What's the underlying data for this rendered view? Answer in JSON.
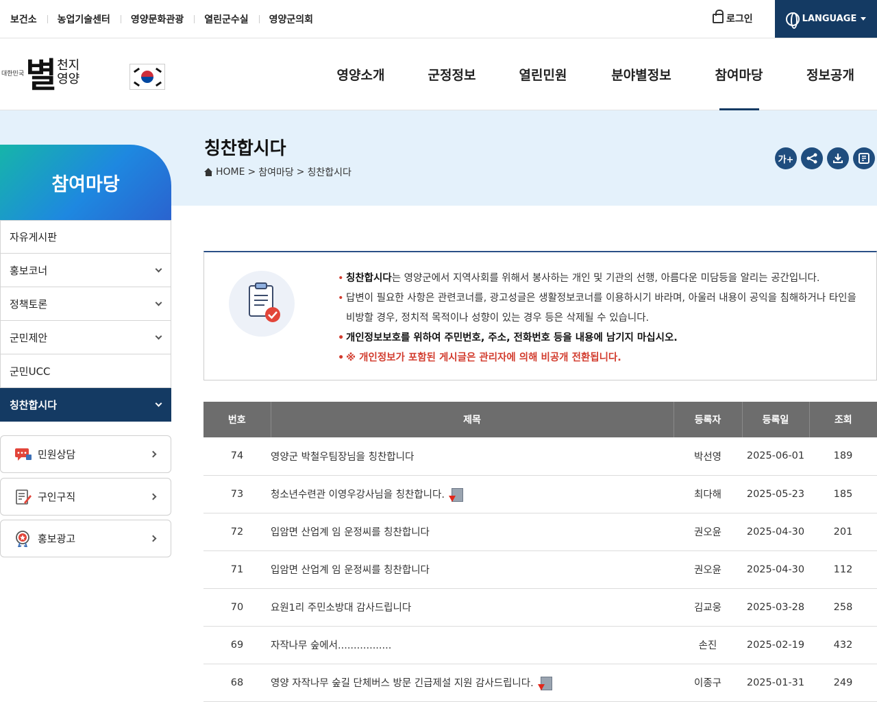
{
  "top_links": [
    "보건소",
    "농업기술센터",
    "영양문화관광",
    "열린군수실",
    "영양군의회"
  ],
  "login_label": "로그인",
  "language_label": "LANGUAGE",
  "logo": {
    "small": "대한민국",
    "big": "별",
    "sub1": "천지",
    "sub2": "영양"
  },
  "gnb": [
    "영양소개",
    "군정정보",
    "열린민원",
    "분야별정보",
    "참여마당",
    "정보공개"
  ],
  "active_gnb_index": 4,
  "page_title": "칭찬합시다",
  "breadcrumb": {
    "home": "HOME",
    "sep": ">",
    "level1": "참여마당",
    "level2": "칭찬합시다"
  },
  "tools": [
    "가+"
  ],
  "lnb": {
    "title": "참여마당",
    "items": [
      {
        "label": "자유게시판",
        "has_sub": false
      },
      {
        "label": "홍보코너",
        "has_sub": true
      },
      {
        "label": "정책토론",
        "has_sub": true
      },
      {
        "label": "군민제안",
        "has_sub": true
      },
      {
        "label": "군민UCC",
        "has_sub": false
      },
      {
        "label": "칭찬합시다",
        "has_sub": true,
        "active": true
      }
    ],
    "quick_links": [
      "민원상담",
      "구인구직",
      "홍보광고"
    ]
  },
  "guide": {
    "line1_bold": "칭찬합시다",
    "line1_rest": "는 영양군에서 지역사회를 위해서 봉사하는 개인 및 기관의 선행, 아름다운 미담등을 알리는 공간입니다.",
    "line2": "답변이 필요한 사항은 관련코너를, 광고성글은 생활정보코너를 이용하시기 바라며, 아울러 내용이 공익을 침해하거나 타인을 비방할 경우, 정치적 목적이나 성향이 있는 경우 등은 삭제될 수 있습니다.",
    "line3": "개인정보보호를 위하여 주민번호, 주소, 전화번호 등을 내용에 남기지 마십시오.",
    "line4": "※ 개인정보가 포함된 게시글은 관리자에 의해 비공개 전환됩니다."
  },
  "table": {
    "headers": [
      "번호",
      "제목",
      "등록자",
      "등록일",
      "조회"
    ],
    "rows": [
      {
        "no": "74",
        "title": "영양군 박철우팀장님을 칭찬합니다",
        "author": "박선영",
        "date": "2025-06-01",
        "views": "189",
        "file": false
      },
      {
        "no": "73",
        "title": "청소년수련관 이영우강사님을 칭찬합니다.",
        "author": "최다해",
        "date": "2025-05-23",
        "views": "185",
        "file": true
      },
      {
        "no": "72",
        "title": "입암면 산업계 임 운정씨를 칭찬합니다",
        "author": "권오윤",
        "date": "2025-04-30",
        "views": "201",
        "file": false
      },
      {
        "no": "71",
        "title": "입암면 산업계 임 운정씨를 칭찬합니다",
        "author": "권오윤",
        "date": "2025-04-30",
        "views": "112",
        "file": false
      },
      {
        "no": "70",
        "title": "요원1리 주민소방대 감사드립니다",
        "author": "김교웅",
        "date": "2025-03-28",
        "views": "258",
        "file": false
      },
      {
        "no": "69",
        "title": "자작나무 숲에서.................",
        "author": "손진",
        "date": "2025-02-19",
        "views": "432",
        "file": false
      },
      {
        "no": "68",
        "title": "영양 자작나무 숲길 단체버스 방문 긴급제설 지원 감사드립니다.",
        "author": "이종구",
        "date": "2025-01-31",
        "views": "249",
        "file": true
      }
    ]
  },
  "colors": {
    "navy": "#143a63",
    "accent_red": "#d23c2e",
    "band": "#e4f1fb",
    "table_head": "#6d6d6d"
  }
}
